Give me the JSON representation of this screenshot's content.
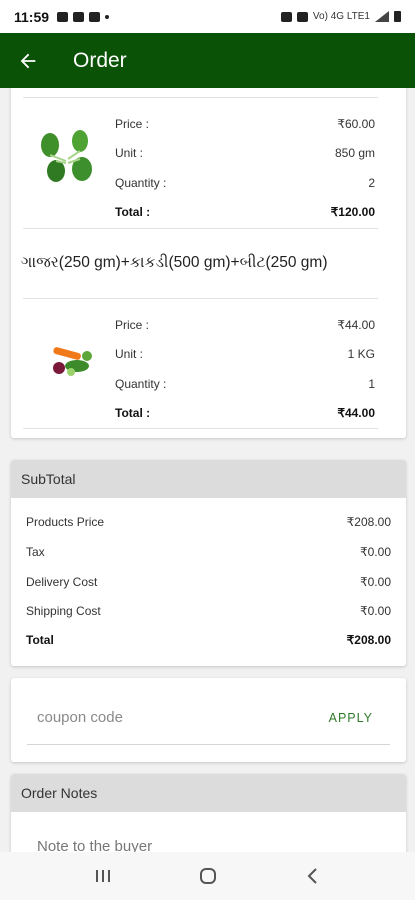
{
  "status_bar": {
    "time": "11:59",
    "network": "Vo) 4G LTE1"
  },
  "app_bar": {
    "title": "Order",
    "back_icon": "arrow-left-icon"
  },
  "items": [
    {
      "name": "",
      "image_icon": "spinach-icon",
      "price_label": "Price :",
      "price": "₹60.00",
      "unit_label": "Unit :",
      "unit": "850 gm",
      "quantity_label": "Quantity :",
      "quantity": "2",
      "total_label": "Total :",
      "total": "₹120.00"
    },
    {
      "name": "ગાજર(250 gm)+કાકડી(500 gm)+બીટ(250 gm)",
      "image_icon": "mixed-vegetables-icon",
      "price_label": "Price :",
      "price": "₹44.00",
      "unit_label": "Unit :",
      "unit": "1 KG",
      "quantity_label": "Quantity :",
      "quantity": "1",
      "total_label": "Total :",
      "total": "₹44.00"
    }
  ],
  "subtotal": {
    "title": "SubTotal",
    "rows": [
      {
        "label": "Products Price",
        "value": "₹208.00"
      },
      {
        "label": "Tax",
        "value": "₹0.00"
      },
      {
        "label": "Delivery Cost",
        "value": "₹0.00"
      },
      {
        "label": "Shipping Cost",
        "value": "₹0.00"
      }
    ],
    "total_label": "Total",
    "total_value": "₹208.00"
  },
  "coupon": {
    "placeholder": "coupon code",
    "apply_label": "APPLY"
  },
  "notes": {
    "title": "Order Notes",
    "placeholder": "Note to the buyer"
  },
  "nav": {
    "recents_icon": "recents-icon",
    "home_icon": "home-icon",
    "back_icon": "back-chevron-icon"
  },
  "colors": {
    "app_bar": "#0a5206",
    "apply": "#2f7d2a",
    "header_bg": "#dcdcdc"
  }
}
